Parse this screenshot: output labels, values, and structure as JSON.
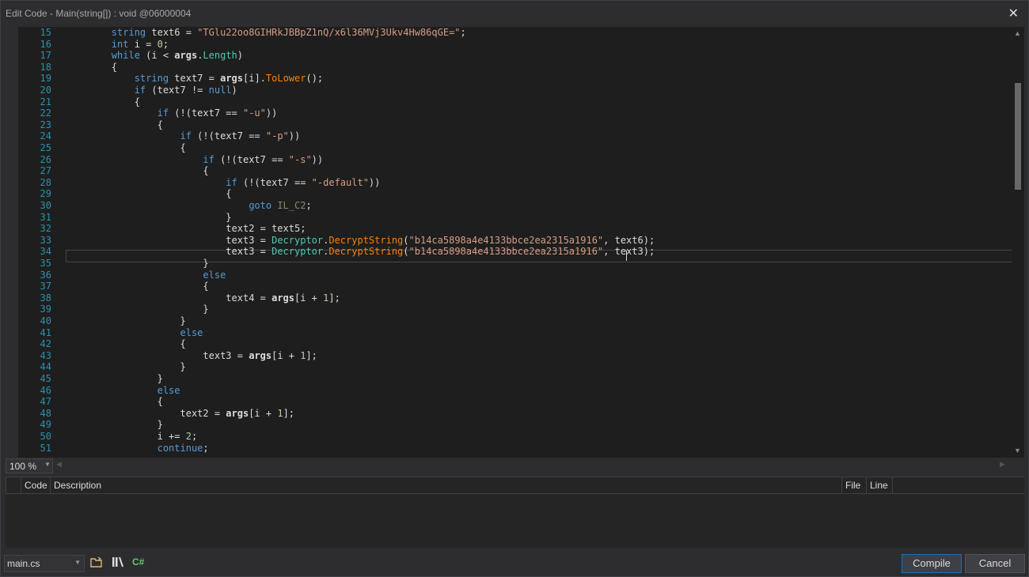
{
  "window": {
    "title": "Edit Code - Main(string[]) : void @06000004",
    "close_glyph": "✕"
  },
  "editor": {
    "lines": [
      {
        "n": "15",
        "tokens": [
          {
            "t": "        "
          },
          {
            "t": "string",
            "c": "kw"
          },
          {
            "t": " text6 = "
          },
          {
            "t": "\"TGlu22oo8GIHRkJBBpZ1nQ/x6l36MVj3Ukv4Hw86qGE=\"",
            "c": "str"
          },
          {
            "t": ";"
          }
        ]
      },
      {
        "n": "16",
        "tokens": [
          {
            "t": "        "
          },
          {
            "t": "int",
            "c": "kw"
          },
          {
            "t": " i = "
          },
          {
            "t": "0",
            "c": "num"
          },
          {
            "t": ";"
          }
        ]
      },
      {
        "n": "17",
        "tokens": [
          {
            "t": "        "
          },
          {
            "t": "while",
            "c": "kw"
          },
          {
            "t": " (i < "
          },
          {
            "t": "args",
            "c": "bold"
          },
          {
            "t": "."
          },
          {
            "t": "Length",
            "c": "typ"
          },
          {
            "t": ")"
          }
        ]
      },
      {
        "n": "18",
        "tokens": [
          {
            "t": "        {"
          }
        ]
      },
      {
        "n": "19",
        "tokens": [
          {
            "t": "            "
          },
          {
            "t": "string",
            "c": "kw"
          },
          {
            "t": " text7 = "
          },
          {
            "t": "args",
            "c": "bold"
          },
          {
            "t": "[i]."
          },
          {
            "t": "ToLower",
            "c": "mth"
          },
          {
            "t": "();"
          }
        ]
      },
      {
        "n": "20",
        "tokens": [
          {
            "t": "            "
          },
          {
            "t": "if",
            "c": "kw"
          },
          {
            "t": " (text7 != "
          },
          {
            "t": "null",
            "c": "kw"
          },
          {
            "t": ")"
          }
        ]
      },
      {
        "n": "21",
        "tokens": [
          {
            "t": "            {"
          }
        ]
      },
      {
        "n": "22",
        "tokens": [
          {
            "t": "                "
          },
          {
            "t": "if",
            "c": "kw"
          },
          {
            "t": " (!(text7 == "
          },
          {
            "t": "\"-u\"",
            "c": "str"
          },
          {
            "t": "))"
          }
        ]
      },
      {
        "n": "23",
        "tokens": [
          {
            "t": "                {"
          }
        ]
      },
      {
        "n": "24",
        "tokens": [
          {
            "t": "                    "
          },
          {
            "t": "if",
            "c": "kw"
          },
          {
            "t": " (!(text7 == "
          },
          {
            "t": "\"-p\"",
            "c": "str"
          },
          {
            "t": "))"
          }
        ]
      },
      {
        "n": "25",
        "tokens": [
          {
            "t": "                    {"
          }
        ]
      },
      {
        "n": "26",
        "tokens": [
          {
            "t": "                        "
          },
          {
            "t": "if",
            "c": "kw"
          },
          {
            "t": " (!(text7 == "
          },
          {
            "t": "\"-s\"",
            "c": "str"
          },
          {
            "t": "))"
          }
        ]
      },
      {
        "n": "27",
        "tokens": [
          {
            "t": "                        {"
          }
        ]
      },
      {
        "n": "28",
        "tokens": [
          {
            "t": "                            "
          },
          {
            "t": "if",
            "c": "kw"
          },
          {
            "t": " (!(text7 == "
          },
          {
            "t": "\"-default\"",
            "c": "str"
          },
          {
            "t": "))"
          }
        ]
      },
      {
        "n": "29",
        "tokens": [
          {
            "t": "                            {"
          }
        ]
      },
      {
        "n": "30",
        "tokens": [
          {
            "t": "                                "
          },
          {
            "t": "goto",
            "c": "kw"
          },
          {
            "t": " "
          },
          {
            "t": "IL_C2",
            "c": "lbl"
          },
          {
            "t": ";"
          }
        ]
      },
      {
        "n": "31",
        "tokens": [
          {
            "t": "                            }"
          }
        ]
      },
      {
        "n": "32",
        "tokens": [
          {
            "t": "                            text2 = text5;"
          }
        ]
      },
      {
        "n": "33",
        "tokens": [
          {
            "t": "                            text3 = "
          },
          {
            "t": "Decryptor",
            "c": "typ"
          },
          {
            "t": "."
          },
          {
            "t": "DecryptString",
            "c": "mth"
          },
          {
            "t": "("
          },
          {
            "t": "\"b14ca5898a4e4133bbce2ea2315a1916\"",
            "c": "str"
          },
          {
            "t": ", text6);"
          }
        ]
      },
      {
        "n": "34",
        "tokens": [
          {
            "t": "                            text3 = "
          },
          {
            "t": "Decryptor",
            "c": "typ"
          },
          {
            "t": "."
          },
          {
            "t": "DecryptString",
            "c": "mth"
          },
          {
            "t": "("
          },
          {
            "t": "\"b14ca5898a4e4133bbce2ea2315a1916\"",
            "c": "str"
          },
          {
            "t": ", text3);"
          }
        ]
      },
      {
        "n": "35",
        "tokens": [
          {
            "t": "                        }"
          }
        ]
      },
      {
        "n": "36",
        "tokens": [
          {
            "t": "                        "
          },
          {
            "t": "else",
            "c": "kw"
          }
        ]
      },
      {
        "n": "37",
        "tokens": [
          {
            "t": "                        {"
          }
        ]
      },
      {
        "n": "38",
        "tokens": [
          {
            "t": "                            text4 = "
          },
          {
            "t": "args",
            "c": "bold"
          },
          {
            "t": "[i + "
          },
          {
            "t": "1",
            "c": "num"
          },
          {
            "t": "];"
          }
        ]
      },
      {
        "n": "39",
        "tokens": [
          {
            "t": "                        }"
          }
        ]
      },
      {
        "n": "40",
        "tokens": [
          {
            "t": "                    }"
          }
        ]
      },
      {
        "n": "41",
        "tokens": [
          {
            "t": "                    "
          },
          {
            "t": "else",
            "c": "kw"
          }
        ]
      },
      {
        "n": "42",
        "tokens": [
          {
            "t": "                    {"
          }
        ]
      },
      {
        "n": "43",
        "tokens": [
          {
            "t": "                        text3 = "
          },
          {
            "t": "args",
            "c": "bold"
          },
          {
            "t": "[i + "
          },
          {
            "t": "1",
            "c": "num"
          },
          {
            "t": "];"
          }
        ]
      },
      {
        "n": "44",
        "tokens": [
          {
            "t": "                    }"
          }
        ]
      },
      {
        "n": "45",
        "tokens": [
          {
            "t": "                }"
          }
        ]
      },
      {
        "n": "46",
        "tokens": [
          {
            "t": "                "
          },
          {
            "t": "else",
            "c": "kw"
          }
        ]
      },
      {
        "n": "47",
        "tokens": [
          {
            "t": "                {"
          }
        ]
      },
      {
        "n": "48",
        "tokens": [
          {
            "t": "                    text2 = "
          },
          {
            "t": "args",
            "c": "bold"
          },
          {
            "t": "[i + "
          },
          {
            "t": "1",
            "c": "num"
          },
          {
            "t": "];"
          }
        ]
      },
      {
        "n": "49",
        "tokens": [
          {
            "t": "                }"
          }
        ]
      },
      {
        "n": "50",
        "tokens": [
          {
            "t": "                i += "
          },
          {
            "t": "2",
            "c": "num"
          },
          {
            "t": ";"
          }
        ]
      },
      {
        "n": "51",
        "tokens": [
          {
            "t": "                "
          },
          {
            "t": "continue",
            "c": "kw"
          },
          {
            "t": ";"
          }
        ]
      }
    ],
    "zoom": "100 %"
  },
  "errors": {
    "columns": {
      "code": "Code",
      "description": "Description",
      "file": "File",
      "line": "Line"
    }
  },
  "footer": {
    "file": "main.cs",
    "csharp_label": "C#",
    "compile_label": "Compile",
    "cancel_label": "Cancel"
  },
  "colors": {
    "keyword": "#569cd6",
    "string": "#d69d85",
    "type": "#4ec9b0",
    "method": "#ff8000",
    "number": "#b5cea8",
    "line_number": "#2b91af",
    "accent": "#007acc"
  },
  "icons": [
    "open-folder-icon",
    "references-icon",
    "csharp-icon",
    "close-icon"
  ]
}
